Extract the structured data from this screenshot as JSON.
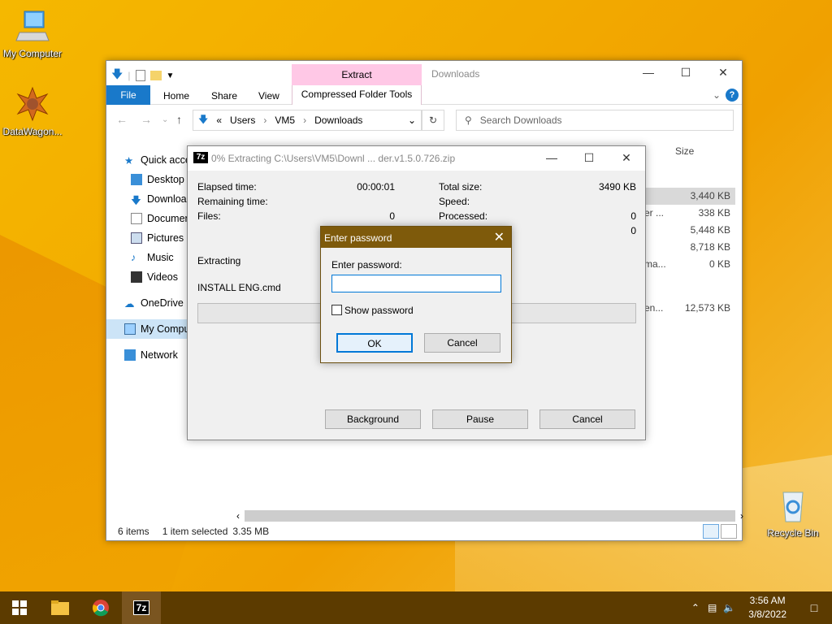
{
  "desktop": {
    "icons": [
      {
        "label": "My Computer"
      },
      {
        "label": "DataWagon..."
      },
      {
        "label": "Recycle Bin"
      }
    ]
  },
  "explorer": {
    "title": "Downloads",
    "contextual_tab_group": "Extract",
    "ribbon_tabs": [
      "File",
      "Home",
      "Share",
      "View"
    ],
    "contextual_tab": "Compressed Folder Tools",
    "address": {
      "prefix": "«",
      "crumbs": [
        "Users",
        "VM5",
        "Downloads"
      ]
    },
    "search_placeholder": "Search Downloads",
    "column_header": "Size",
    "nav_items": [
      {
        "label": "Quick access",
        "icon": "star-icon"
      },
      {
        "label": "Desktop",
        "icon": "desktop-icon"
      },
      {
        "label": "Downloads",
        "icon": "download-icon"
      },
      {
        "label": "Documents",
        "icon": "document-icon"
      },
      {
        "label": "Pictures",
        "icon": "pictures-icon"
      },
      {
        "label": "Music",
        "icon": "music-icon"
      },
      {
        "label": "Videos",
        "icon": "videos-icon"
      },
      {
        "label": "OneDrive",
        "icon": "cloud-icon"
      },
      {
        "label": "My Computer",
        "icon": "computer-icon"
      },
      {
        "label": "Network",
        "icon": "network-icon"
      }
    ],
    "file_sizes": [
      "3,440 KB",
      "338 KB",
      "5,448 KB",
      "8,718 KB",
      "0 KB",
      "12,573 KB"
    ],
    "truncated_types": [
      "er ...",
      "ma...",
      "en..."
    ],
    "status": {
      "items": "6 items",
      "selected": "1 item selected",
      "size": "3.35 MB"
    }
  },
  "zip_dialog": {
    "title": "0% Extracting C:\\Users\\VM5\\Downl ... der.v1.5.0.726.zip",
    "elapsed_label": "Elapsed time:",
    "elapsed_value": "00:00:01",
    "remaining_label": "Remaining time:",
    "files_label": "Files:",
    "files_value": "0",
    "total_size_label": "Total size:",
    "total_size_value": "3490 KB",
    "speed_label": "Speed:",
    "processed_label": "Processed:",
    "processed_value": "0",
    "compressed_value": "0",
    "status_text": "Extracting",
    "current_file": "INSTALL ENG.cmd",
    "progress": 0,
    "buttons": {
      "background": "Background",
      "pause": "Pause",
      "cancel": "Cancel"
    }
  },
  "password_dialog": {
    "title": "Enter password",
    "label": "Enter password:",
    "value": "",
    "show_password_label": "Show password",
    "show_password_checked": false,
    "ok": "OK",
    "cancel": "Cancel"
  },
  "taskbar": {
    "time": "3:56 AM",
    "date": "3/8/2022",
    "colors": {
      "bar": "#5c3b00",
      "accent": "#7e5a0b"
    }
  }
}
